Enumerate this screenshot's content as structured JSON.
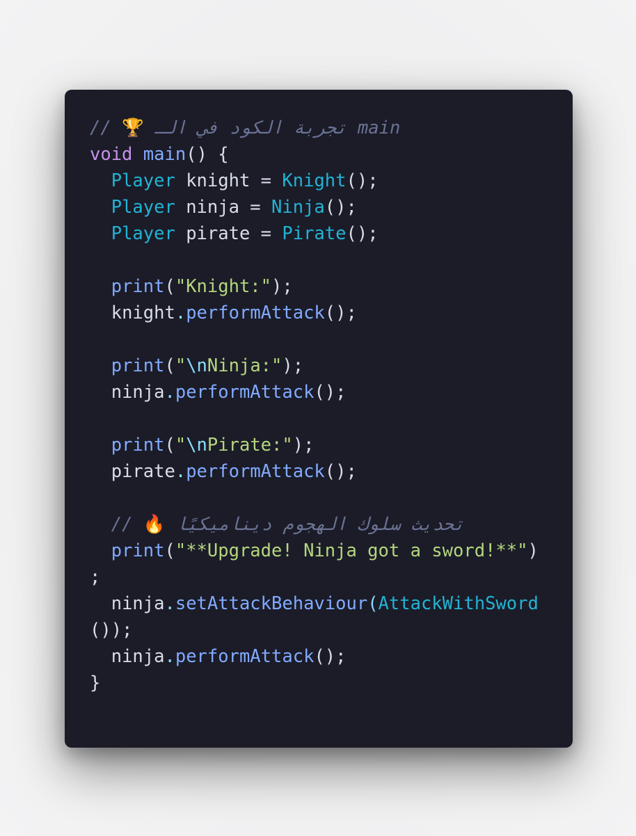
{
  "code_lines": {
    "l1": {
      "comment_prefix": "// ",
      "emoji": "🏆",
      "arabic": " تجربة الكود في الـ main"
    },
    "l2": {
      "kw": "void",
      "fn": "main",
      "rest": "() {"
    },
    "l3": {
      "indent": "  ",
      "type": "Player",
      "mid": " knight = ",
      "ctor": "Knight",
      "end": "();"
    },
    "l4": {
      "indent": "  ",
      "type": "Player",
      "mid": " ninja = ",
      "ctor": "Ninja",
      "end": "();"
    },
    "l5": {
      "indent": "  ",
      "type": "Player",
      "mid": " pirate = ",
      "ctor": "Pirate",
      "end": "();"
    },
    "l7": {
      "indent": "  ",
      "fn": "print",
      "open": "(",
      "str": "\"Knight:\"",
      "end": ");"
    },
    "l8": {
      "indent": "  ",
      "obj": "knight",
      "dot": ".",
      "fn": "performAttack",
      "end": "();"
    },
    "l10": {
      "indent": "  ",
      "fn": "print",
      "open": "(",
      "q": "\"",
      "esc": "\\n",
      "str": "Ninja:\"",
      "end": ");"
    },
    "l11": {
      "indent": "  ",
      "obj": "ninja",
      "dot": ".",
      "fn": "performAttack",
      "end": "();"
    },
    "l13": {
      "indent": "  ",
      "fn": "print",
      "open": "(",
      "q": "\"",
      "esc": "\\n",
      "str": "Pirate:\"",
      "end": ");"
    },
    "l14": {
      "indent": "  ",
      "obj": "pirate",
      "dot": ".",
      "fn": "performAttack",
      "end": "();"
    },
    "l16": {
      "indent": "  ",
      "comment_prefix": "// ",
      "emoji": "🔥",
      "arabic": " تحديث سلوك الهجوم ديناميكيًا"
    },
    "l17": {
      "indent": "  ",
      "fn": "print",
      "open": "(",
      "str": "\"**Upgrade! Ninja got a sword!**\"",
      "end": ")"
    },
    "l18": {
      "text": ";"
    },
    "l19": {
      "indent": "  ",
      "obj": "ninja",
      "dot": ".",
      "fn": "setAttackBehaviour",
      "open": "(",
      "ctor": "AttackWithSword"
    },
    "l20": {
      "text": "());"
    },
    "l21": {
      "indent": "  ",
      "obj": "ninja",
      "dot": ".",
      "fn": "performAttack",
      "end": "();"
    },
    "l22": {
      "text": "}"
    }
  },
  "colors": {
    "background": "#1b1c28",
    "comment": "#6b7394",
    "keyword": "#c991ea",
    "function": "#82aaff",
    "type": "#22b3d4",
    "string": "#b5d67e",
    "escape": "#89ddff",
    "plain": "#d9dde8"
  }
}
